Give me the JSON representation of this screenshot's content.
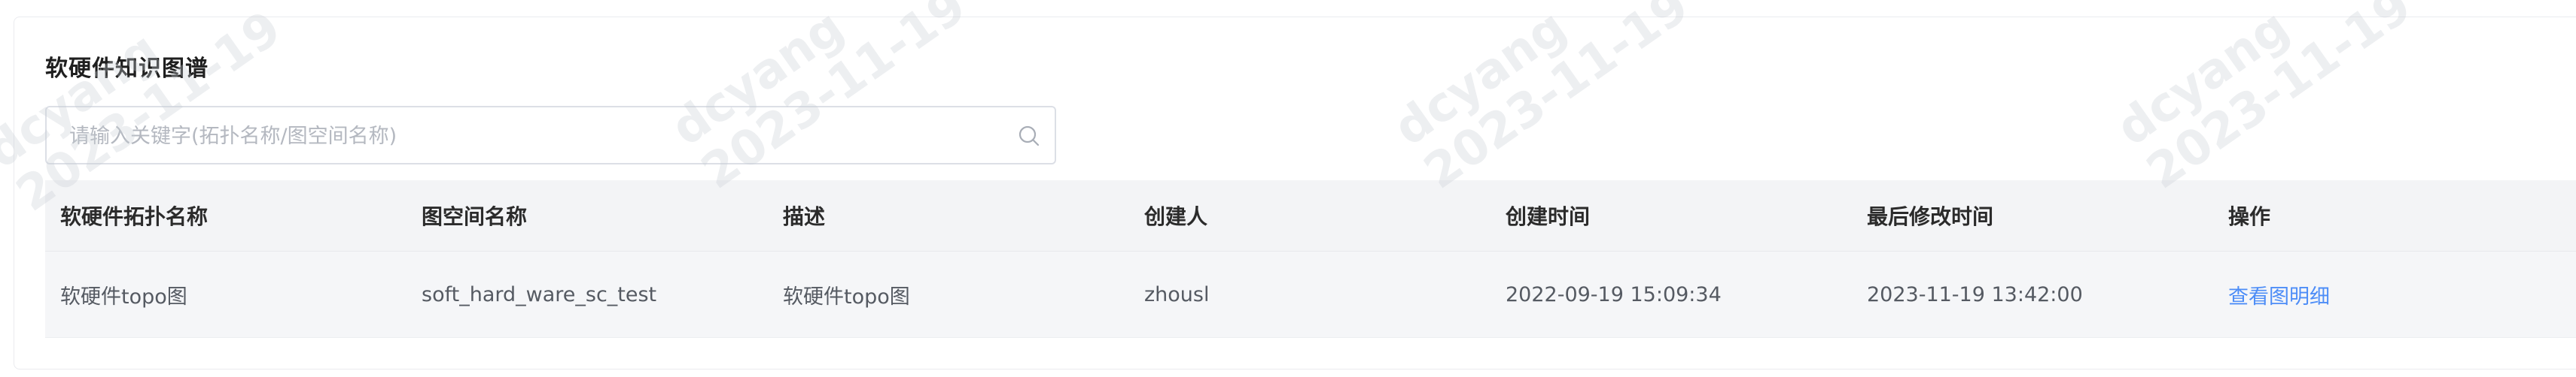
{
  "section": {
    "title": "软硬件知识图谱"
  },
  "search": {
    "placeholder": "请输入关键字(拓扑名称/图空间名称)",
    "value": "",
    "icon": "search-icon"
  },
  "table": {
    "columns": [
      "软硬件拓扑名称",
      "图空间名称",
      "描述",
      "创建人",
      "创建时间",
      "最后修改时间",
      "操作"
    ],
    "rows": [
      {
        "topology_name": "软硬件topo图",
        "space_name": "soft_hard_ware_sc_test",
        "description": "软硬件topo图",
        "creator": "zhousl",
        "created_at": "2022-09-19 15:09:34",
        "updated_at": "2023-11-19 13:42:00",
        "action": "查看图明细"
      }
    ]
  },
  "watermark": {
    "user": "dcyang",
    "date": "2023-11-19"
  },
  "colors": {
    "link": "#4d8df7",
    "header_bg": "#f3f4f6",
    "row_bg": "#f5f6f8"
  }
}
